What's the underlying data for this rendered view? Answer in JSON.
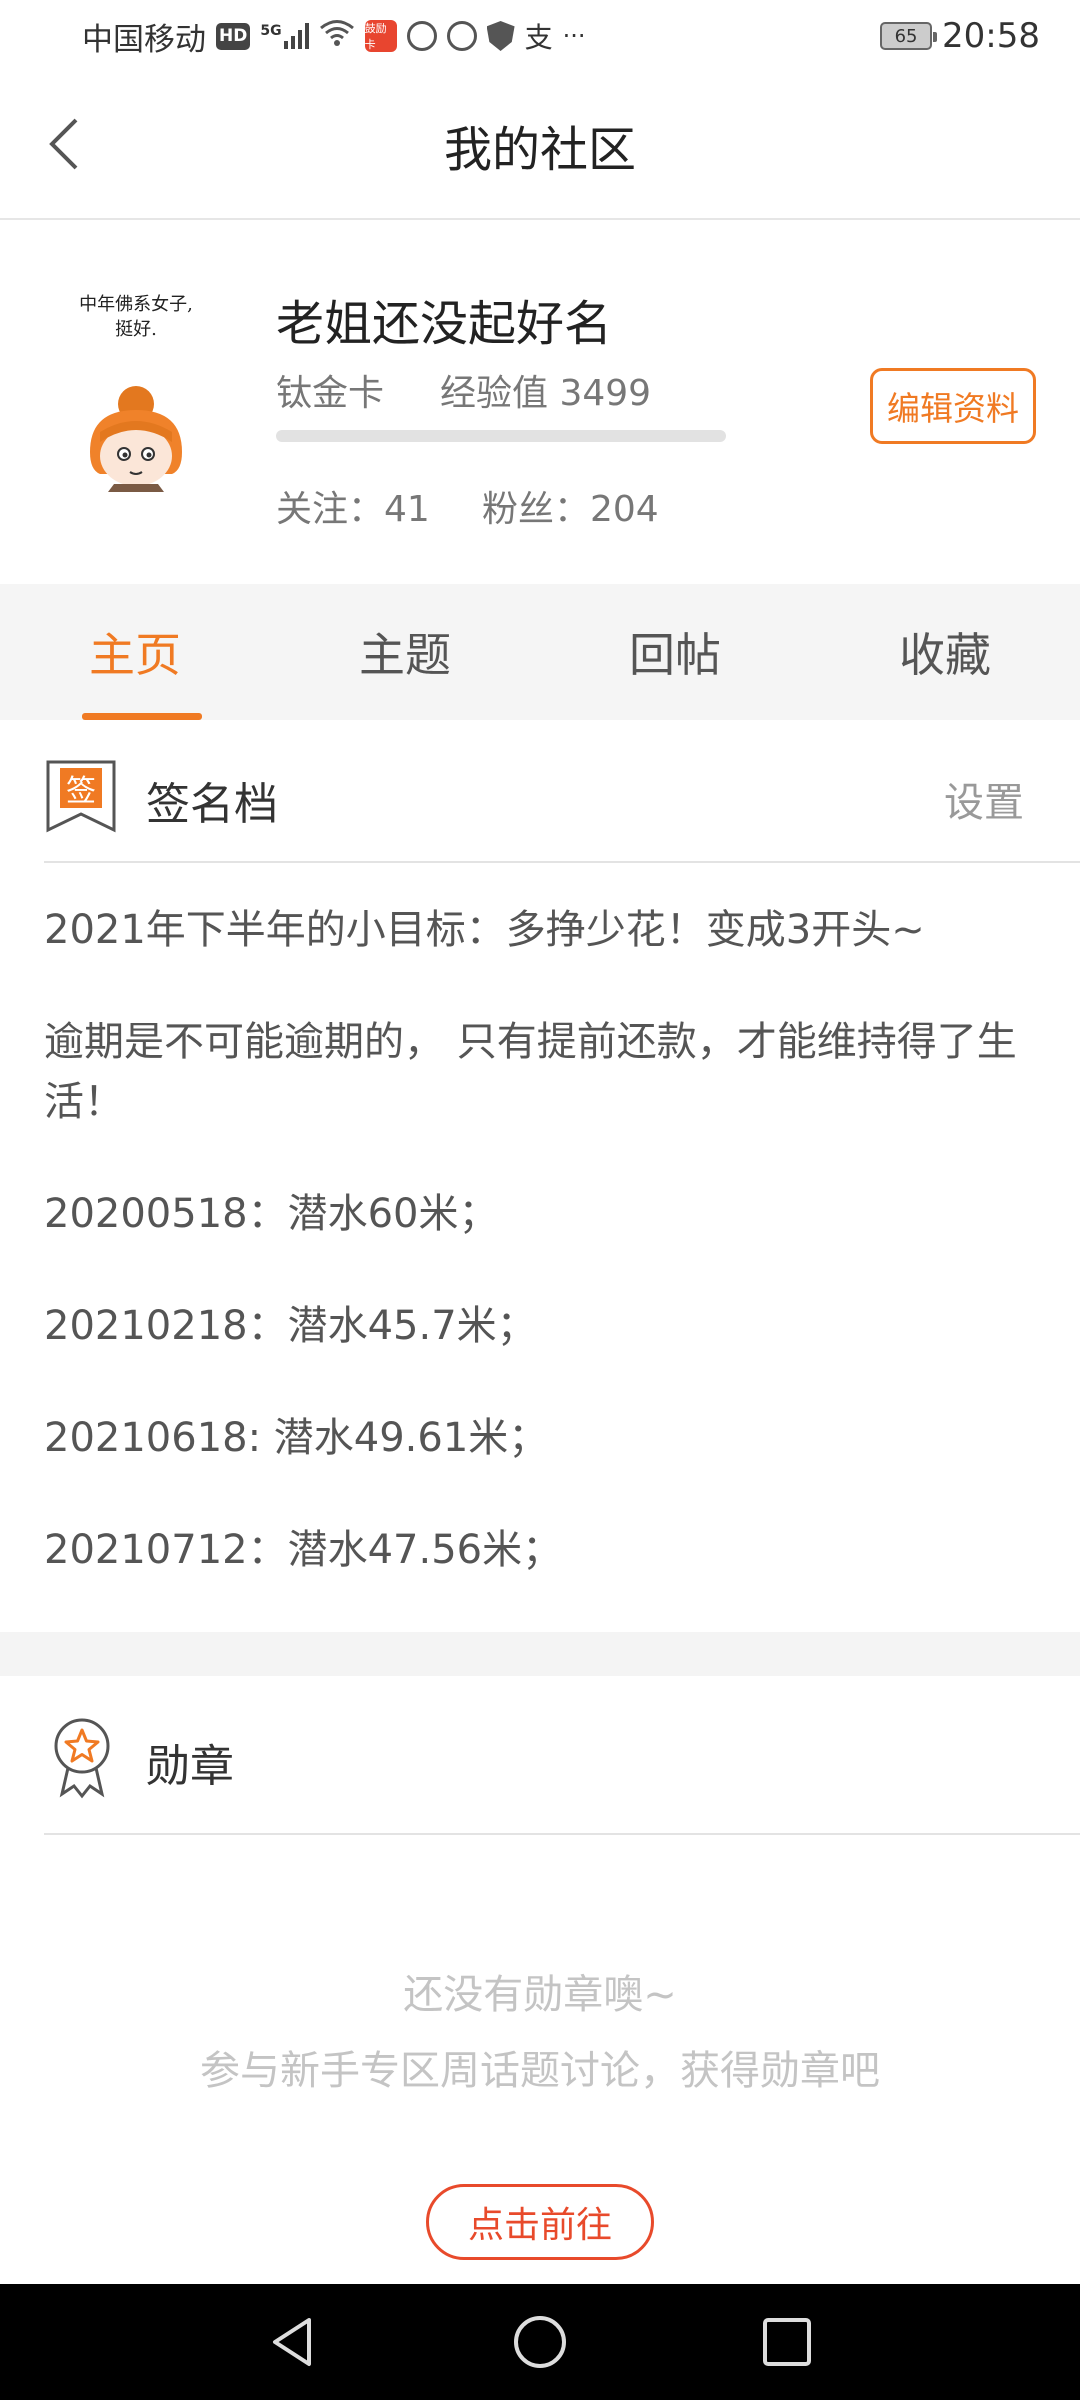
{
  "status_bar": {
    "carrier": "中国移动",
    "hd": "HD",
    "net": "5G",
    "app_badge": "鼓励卡",
    "alipay": "支",
    "more": "···",
    "battery": "65",
    "time": "20:58"
  },
  "header": {
    "title": "我的社区"
  },
  "profile": {
    "avatar_text_line1": "中年佛系女子,",
    "avatar_text_line2": "挺好.",
    "username": "老姐还没起好名",
    "card_level": "钛金卡",
    "exp_text": "经验值 3499",
    "exp_progress": 0,
    "follow_text": "关注：41",
    "fans_text": "粉丝：204",
    "edit_label": "编辑资料"
  },
  "tabs": [
    {
      "label": "主页",
      "active": true
    },
    {
      "label": "主题",
      "active": false
    },
    {
      "label": "回帖",
      "active": false
    },
    {
      "label": "收藏",
      "active": false
    }
  ],
  "signature": {
    "icon_char": "签",
    "title": "签名档",
    "settings_label": "设置",
    "lines": [
      "2021年下半年的小目标：多挣少花！变成3开头~",
      "逾期是不可能逾期的， 只有提前还款，才能维持得了生活！",
      "20200518：潜水60米；",
      "20210218：潜水45.7米；",
      "20210618: 潜水49.61米；",
      "20210712：潜水47.56米；"
    ]
  },
  "medals": {
    "title": "勋章",
    "empty_line1": "还没有勋章噢~",
    "empty_line2": "参与新手专区周话题讨论，获得勋章吧",
    "go_label": "点击前往"
  },
  "colors": {
    "accent": "#f07a23",
    "go_red": "#e84a2b",
    "tab_bg": "#f5f5f5",
    "navbar": "#000000"
  },
  "nav": {
    "back_icon": "back-triangle-icon",
    "home_icon": "home-circle-icon",
    "recents_icon": "recents-square-icon"
  }
}
